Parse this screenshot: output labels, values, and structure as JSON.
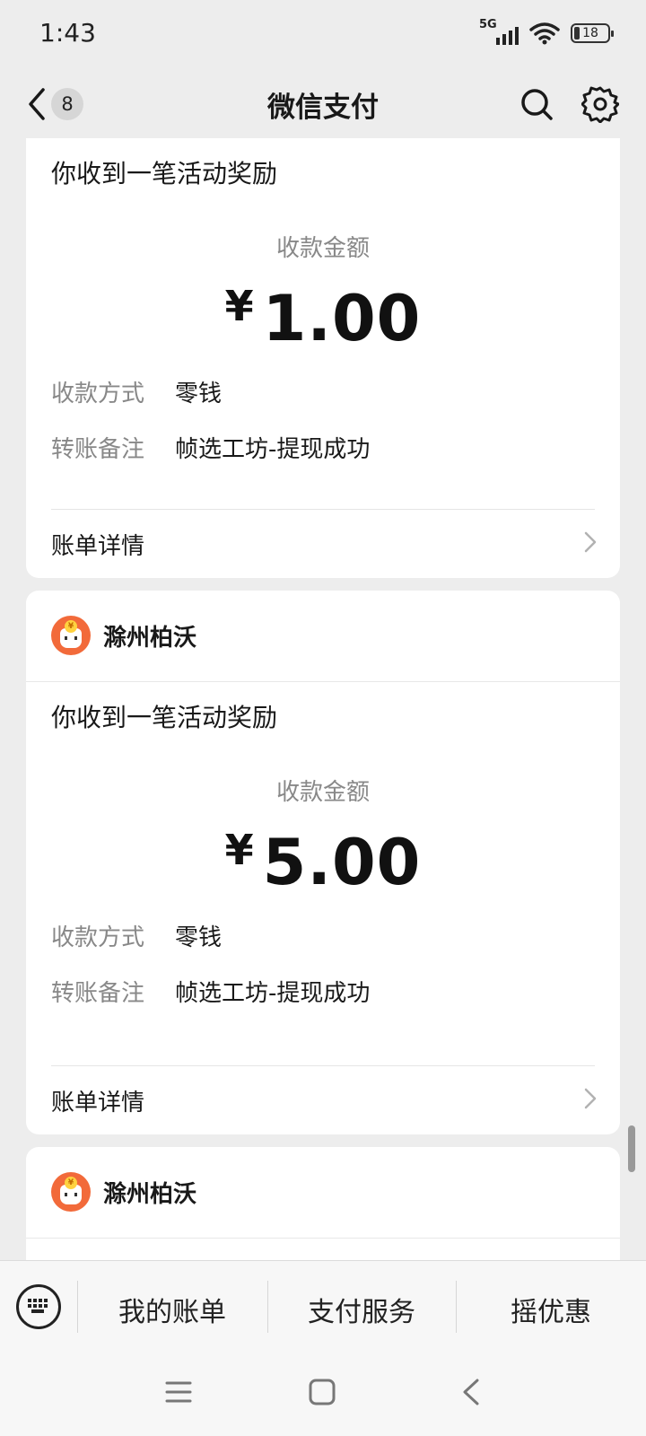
{
  "status_bar": {
    "time": "1:43",
    "network": "5G",
    "battery": "18"
  },
  "nav": {
    "back_badge": "8",
    "title": "微信支付"
  },
  "cards": [
    {
      "message_title": "你收到一笔活动奖励",
      "amount_label": "收款金额",
      "currency": "¥",
      "amount": "1.00",
      "method_label": "收款方式",
      "method_value": "零钱",
      "note_label": "转账备注",
      "note_value": "帧选工坊-提现成功",
      "detail_label": "账单详情"
    },
    {
      "merchant": "滁州柏沃",
      "message_title": "你收到一笔活动奖励",
      "amount_label": "收款金额",
      "currency": "¥",
      "amount": "5.00",
      "method_label": "收款方式",
      "method_value": "零钱",
      "note_label": "转账备注",
      "note_value": "帧选工坊-提现成功",
      "detail_label": "账单详情"
    },
    {
      "merchant": "滁州柏沃"
    }
  ],
  "bottom_menu": {
    "items": [
      "我的账单",
      "支付服务",
      "摇优惠"
    ]
  },
  "icons": {
    "back": "chevron-left-icon",
    "search": "search-icon",
    "settings": "gear-icon",
    "keyboard": "keyboard-icon",
    "merchant_logo": "piggy-jar-icon"
  },
  "colors": {
    "background": "#ededed",
    "card": "#ffffff",
    "merchant_logo": "#f26a3a",
    "label_gray": "#888888"
  }
}
